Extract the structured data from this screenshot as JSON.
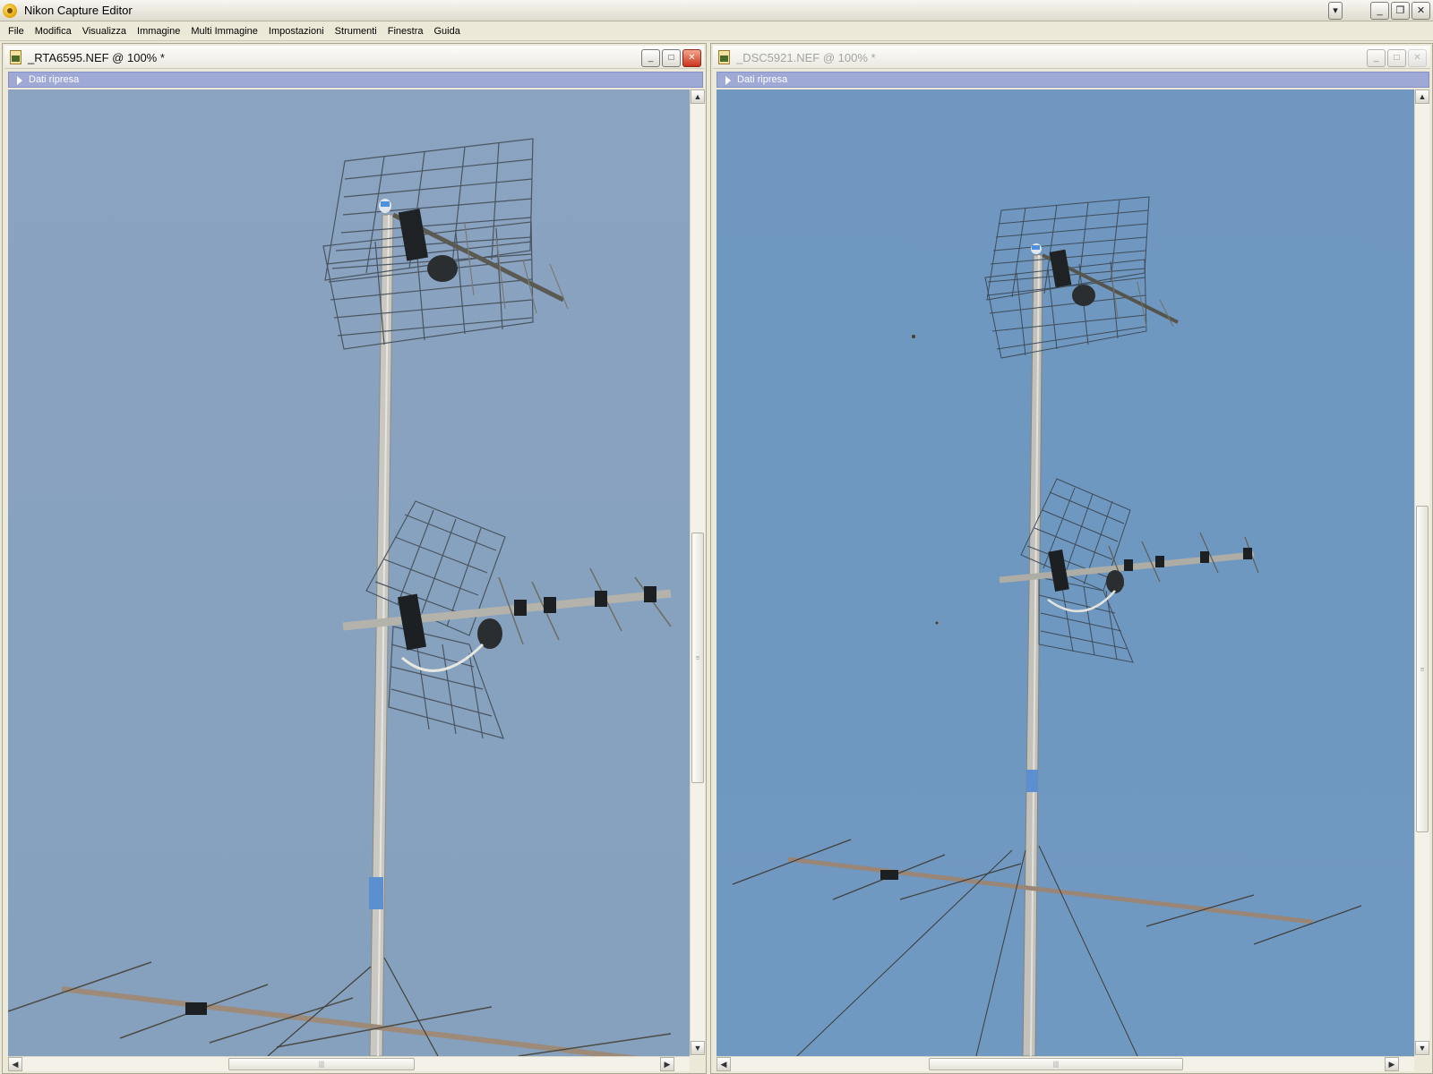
{
  "app": {
    "title": "Nikon Capture Editor",
    "controls": {
      "menu_dropdown": "▾",
      "minimize": "_",
      "restore": "❐",
      "close": "✕"
    }
  },
  "menu": [
    "File",
    "Modifica",
    "Visualizza",
    "Immagine",
    "Multi Immagine",
    "Impostazioni",
    "Strumenti",
    "Finestra",
    "Guida"
  ],
  "windows": {
    "left": {
      "title": "_RTA6595.NEF @ 100% *",
      "info_label": "Dati ripresa",
      "active": true,
      "sky_color": "#88a2bf",
      "controls": {
        "minimize": "_",
        "maximize": "□",
        "close": "✕"
      },
      "scroll": {
        "up": "▲",
        "down": "▼",
        "left": "◀",
        "right": "▶",
        "grip_v": "≡",
        "grip_h": "|||"
      }
    },
    "right": {
      "title": "_DSC5921.NEF @ 100% *",
      "info_label": "Dati ripresa",
      "active": false,
      "sky_color": "#6f98c0",
      "controls": {
        "minimize": "_",
        "maximize": "□",
        "close": "✕"
      },
      "scroll": {
        "up": "▲",
        "down": "▼",
        "left": "◀",
        "right": "▶",
        "grip_v": "≡",
        "grip_h": "|||"
      }
    }
  }
}
